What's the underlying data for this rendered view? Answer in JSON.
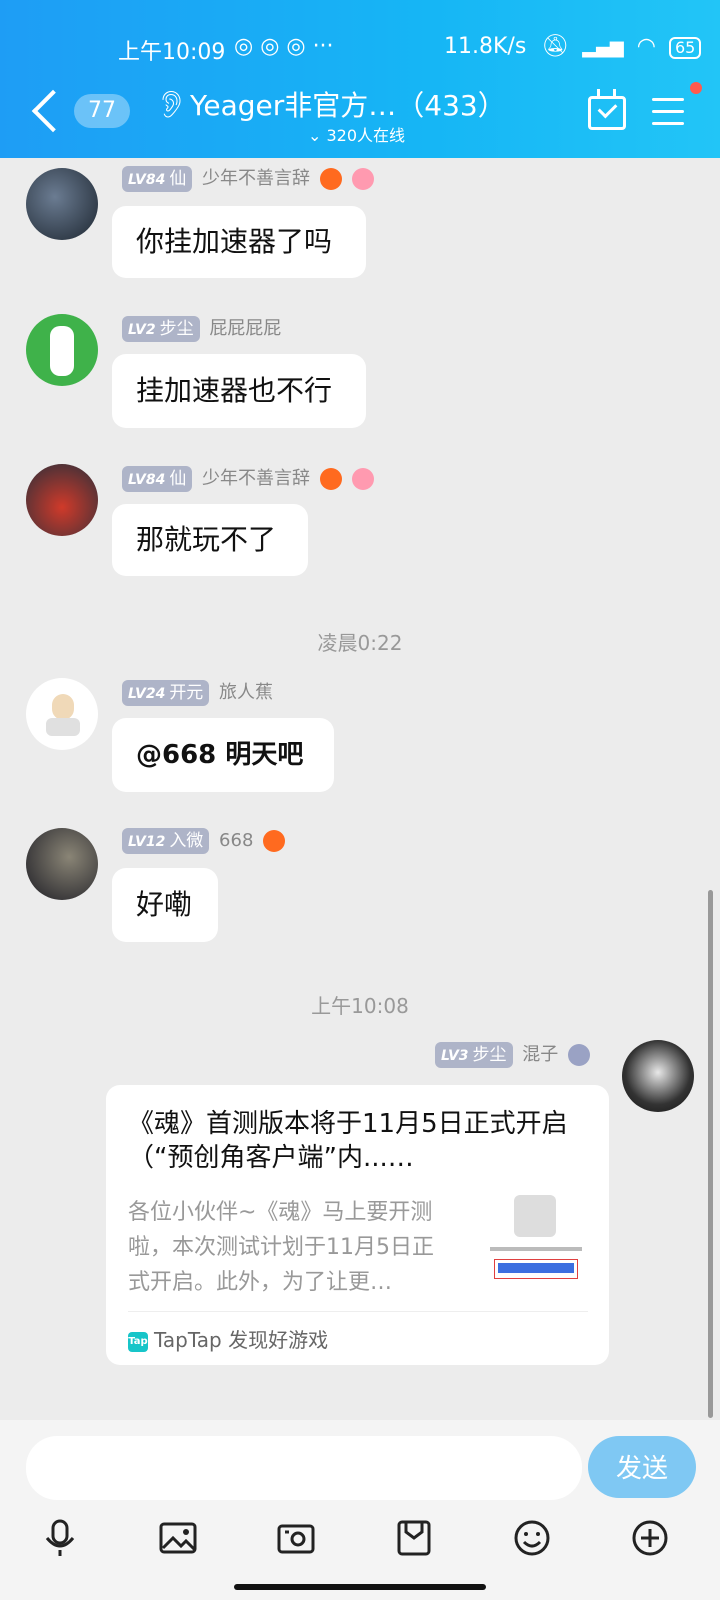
{
  "status_bar": {
    "time": "上午10:09",
    "dots": "◎ ◎ ◎ ···",
    "network_speed": "11.8K/s",
    "battery": "65"
  },
  "header": {
    "back_count": "77",
    "group_name": "Yeager非官方…（433）",
    "online": "320人在线"
  },
  "messages": [
    {
      "level": "LV84",
      "rank": "仙",
      "nick": "少年不善言辞",
      "text": "你挂加速器了吗"
    },
    {
      "level": "LV2",
      "rank": "步尘",
      "nick": "屁屁屁屁",
      "text": "挂加速器也不行"
    },
    {
      "level": "LV84",
      "rank": "仙",
      "nick": "少年不善言辞",
      "text": "那就玩不了"
    },
    {
      "level": "LV24",
      "rank": "开元",
      "nick": "旅人蕉",
      "text": "@668 明天吧"
    },
    {
      "level": "LV12",
      "rank": "入微",
      "nick": "668",
      "text": "好嘞"
    }
  ],
  "time_separators": [
    "凌晨0:22",
    "上午10:08"
  ],
  "my_message": {
    "level": "LV3",
    "rank": "步尘",
    "nick": "混子",
    "card_title": "《魂》首测版本将于11月5日正式开启（“预创角客户端”内...…",
    "card_desc": "各位小伙伴~《魂》马上要开测啦，本次测试计划于11月5日正式开启。此外，为了让更…",
    "card_source": "TapTap 发现好游戏",
    "tap_icon": "Tap"
  },
  "input": {
    "placeholder": "",
    "send_label": "发送"
  },
  "toolbar": [
    "mic-icon",
    "image-icon",
    "camera-icon",
    "sticker-icon",
    "emoji-icon",
    "plus-icon"
  ],
  "colors": {
    "header_start": "#1e9df5",
    "header_end": "#22c5f7",
    "level_badge": "#aeb4c8",
    "send_button": "#7fc8f3",
    "chat_background": "#ececec"
  }
}
